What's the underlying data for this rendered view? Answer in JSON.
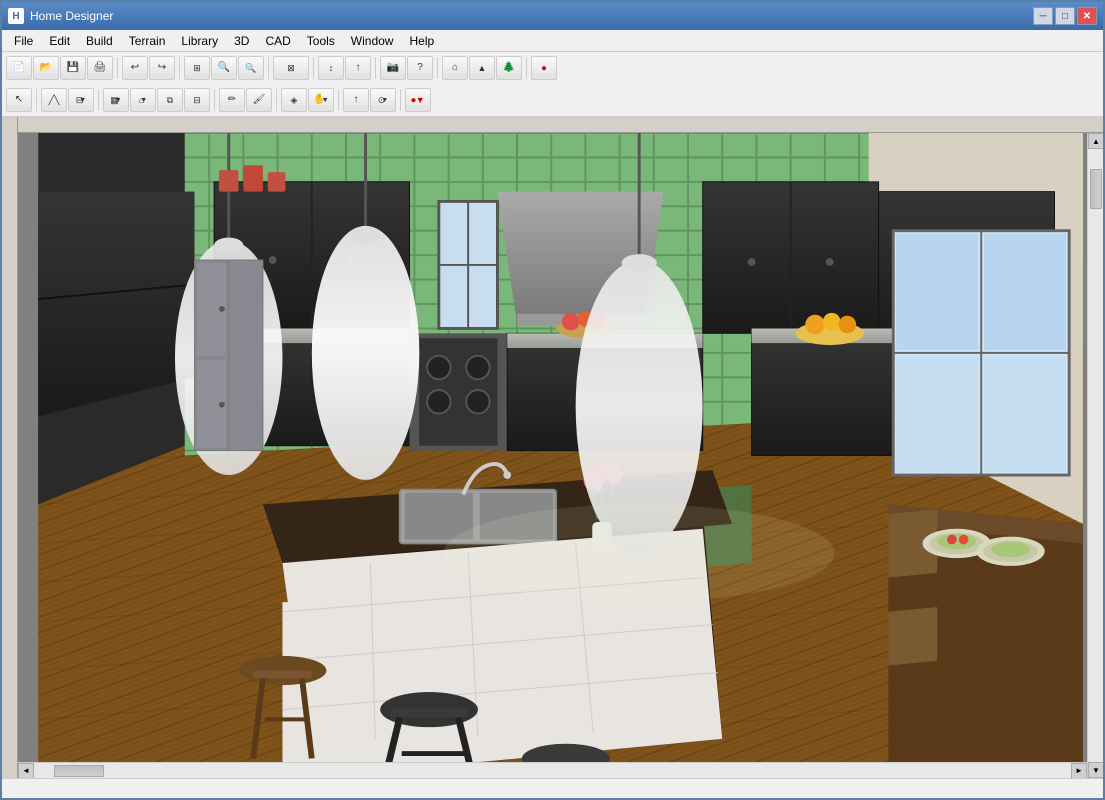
{
  "window": {
    "title": "Home Designer",
    "icon": "H"
  },
  "titlebar": {
    "title": "Home Designer",
    "controls": {
      "minimize": "─",
      "maximize": "□",
      "close": "✕"
    }
  },
  "menubar": {
    "items": [
      {
        "id": "file",
        "label": "File"
      },
      {
        "id": "edit",
        "label": "Edit"
      },
      {
        "id": "build",
        "label": "Build"
      },
      {
        "id": "terrain",
        "label": "Terrain"
      },
      {
        "id": "library",
        "label": "Library"
      },
      {
        "id": "3d",
        "label": "3D"
      },
      {
        "id": "cad",
        "label": "CAD"
      },
      {
        "id": "tools",
        "label": "Tools"
      },
      {
        "id": "window",
        "label": "Window"
      },
      {
        "id": "help",
        "label": "Help"
      }
    ]
  },
  "toolbar1": {
    "buttons": [
      {
        "id": "new",
        "icon": "📄",
        "label": "New"
      },
      {
        "id": "open",
        "icon": "📂",
        "label": "Open"
      },
      {
        "id": "save",
        "icon": "💾",
        "label": "Save"
      },
      {
        "id": "print",
        "icon": "🖨",
        "label": "Print"
      },
      {
        "id": "undo",
        "icon": "↩",
        "label": "Undo"
      },
      {
        "id": "redo",
        "icon": "↪",
        "label": "Redo"
      },
      {
        "id": "zoom-in-box",
        "icon": "🔍",
        "label": "Zoom In Box"
      },
      {
        "id": "zoom-in",
        "icon": "+",
        "label": "Zoom In"
      },
      {
        "id": "zoom-out",
        "icon": "−",
        "label": "Zoom Out"
      },
      {
        "id": "fill-window",
        "icon": "⊞",
        "label": "Fill Window"
      },
      {
        "id": "undo2",
        "icon": "↩",
        "label": "Undo2"
      },
      {
        "id": "camera",
        "icon": "📷",
        "label": "Camera"
      },
      {
        "id": "walls",
        "icon": "⊓",
        "label": "Walls"
      },
      {
        "id": "help",
        "icon": "?",
        "label": "Help"
      },
      {
        "id": "house",
        "icon": "⌂",
        "label": "House"
      },
      {
        "id": "roof",
        "icon": "△",
        "label": "Roof"
      },
      {
        "id": "tree",
        "icon": "🌲",
        "label": "Tree"
      },
      {
        "id": "rec",
        "icon": "⏺",
        "label": "Record"
      }
    ]
  },
  "toolbar2": {
    "buttons": [
      {
        "id": "select",
        "icon": "↖",
        "label": "Select"
      },
      {
        "id": "polyline",
        "icon": "╱",
        "label": "Polyline"
      },
      {
        "id": "wall",
        "icon": "⊏",
        "label": "Wall"
      },
      {
        "id": "box",
        "icon": "▦",
        "label": "Box"
      },
      {
        "id": "roof2",
        "icon": "⌂",
        "label": "Roof"
      },
      {
        "id": "cabinet",
        "icon": "▣",
        "label": "Cabinet"
      },
      {
        "id": "stairs",
        "icon": "≡",
        "label": "Stairs"
      },
      {
        "id": "paint",
        "icon": "✏",
        "label": "Paint"
      },
      {
        "id": "material",
        "icon": "◈",
        "label": "Material"
      },
      {
        "id": "hand",
        "icon": "✋",
        "label": "Hand"
      },
      {
        "id": "arrow",
        "icon": "↑",
        "label": "Arrow"
      },
      {
        "id": "cam2",
        "icon": "⊙",
        "label": "Camera2"
      },
      {
        "id": "record2",
        "icon": "⏺",
        "label": "Record2"
      }
    ]
  },
  "statusbar": {
    "text": ""
  },
  "scene": {
    "description": "3D kitchen render with dark cabinets, green tile backsplash, kitchen island with sink, pendant lights, hardwood floors, dining table"
  }
}
